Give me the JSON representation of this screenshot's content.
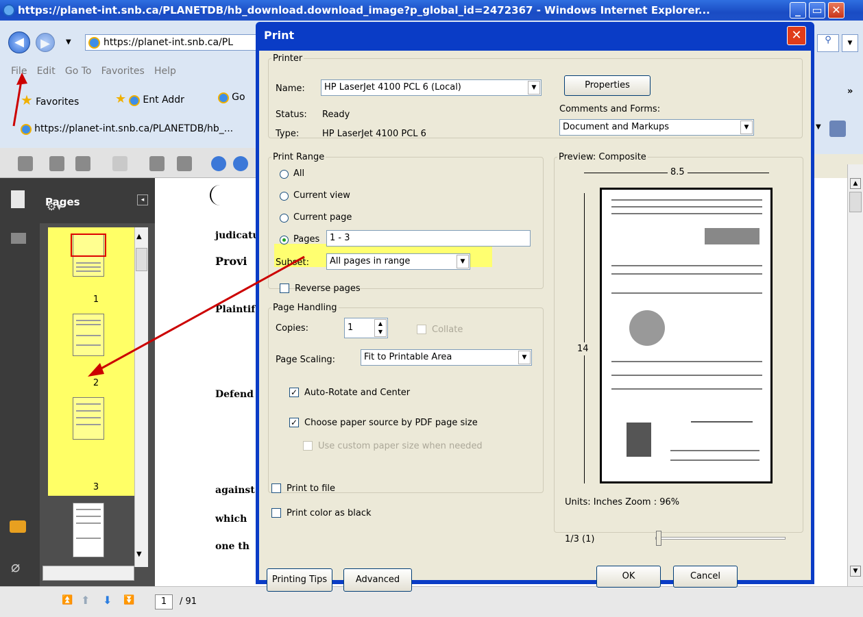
{
  "browser": {
    "title": "https://planet-int.snb.ca/PLANETDB/hb_download.download_image?p_global_id=2472367 - Windows Internet Explorer...",
    "address": "https://planet-int.snb.ca/PL",
    "menu": [
      "File",
      "Edit",
      "Go To",
      "Favorites",
      "Help"
    ],
    "favorites_label": "Favorites",
    "fav_links": [
      "Ent Addr",
      "Go"
    ],
    "tab_title": "https://planet-int.snb.ca/PLANETDB/hb_..."
  },
  "reader": {
    "pages_panel_title": "Pages",
    "thumb_labels": [
      "1",
      "2",
      "3"
    ],
    "doc_lines": [
      "judicatu",
      "Provi",
      "Plaintif",
      "Defend",
      "against",
      "which",
      "one th"
    ],
    "page_input": "1",
    "page_total": "/ 91"
  },
  "dialog": {
    "title": "Print",
    "printer": {
      "legend": "Printer",
      "name_label": "Name:",
      "name_value": "HP LaserJet 4100 PCL 6 (Local)",
      "status_label": "Status:",
      "status_value": "Ready",
      "type_label": "Type:",
      "type_value": "HP LaserJet 4100 PCL 6",
      "properties_button": "Properties",
      "comments_label": "Comments and Forms:",
      "comments_value": "Document and Markups"
    },
    "range": {
      "legend": "Print Range",
      "all": "All",
      "current_view": "Current view",
      "current_page": "Current page",
      "pages": "Pages",
      "pages_value": "1 - 3",
      "subset_label": "Subset:",
      "subset_value": "All pages in range",
      "reverse": "Reverse pages"
    },
    "handling": {
      "legend": "Page Handling",
      "copies_label": "Copies:",
      "copies_value": "1",
      "collate": "Collate",
      "scaling_label": "Page Scaling:",
      "scaling_value": "Fit to Printable Area",
      "auto_rotate": "Auto-Rotate and Center",
      "paper_source": "Choose paper source by PDF page size",
      "custom_paper": "Use custom paper size when needed"
    },
    "print_to_file": "Print to file",
    "print_color_black": "Print color as black",
    "preview": {
      "legend": "Preview: Composite",
      "width": "8.5",
      "height": "14",
      "units": "Units: Inches Zoom :  96%",
      "page_indicator": "1/3 (1)"
    },
    "buttons": {
      "tips": "Printing Tips",
      "advanced": "Advanced",
      "ok": "OK",
      "cancel": "Cancel"
    }
  }
}
